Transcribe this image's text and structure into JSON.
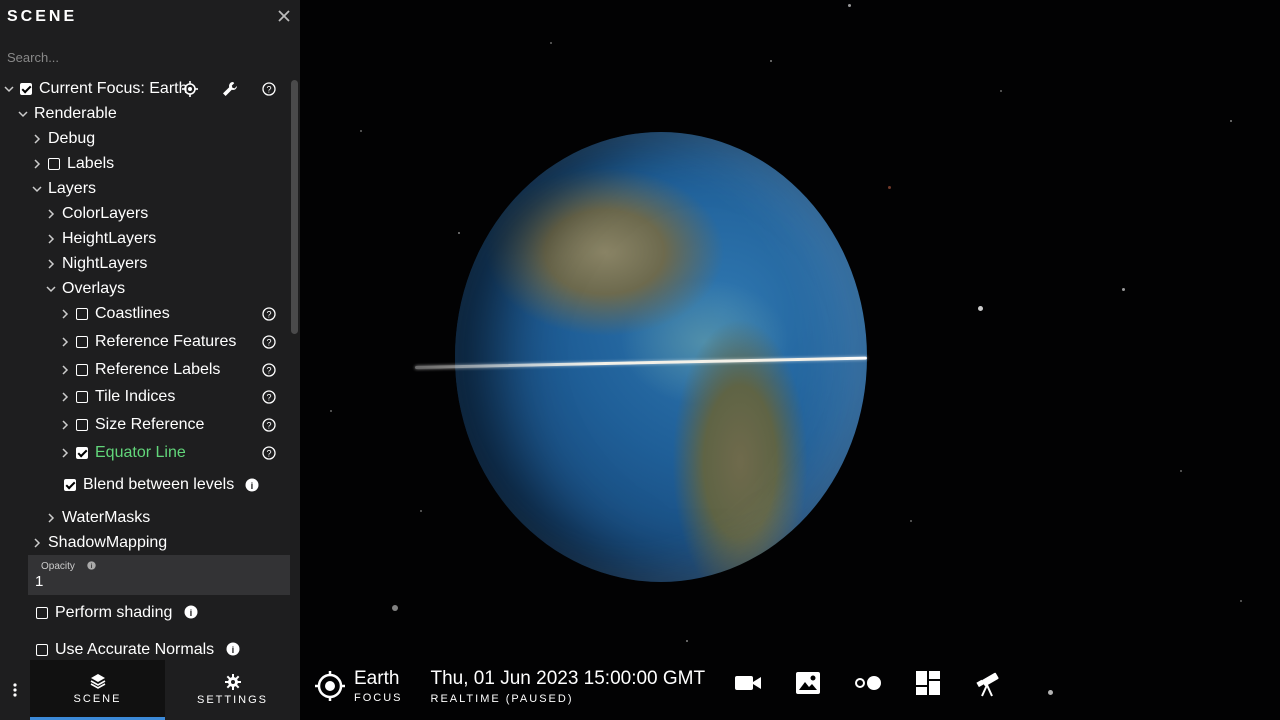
{
  "sidebar": {
    "title": "SCENE",
    "search_placeholder": "Search...",
    "tree": {
      "current_focus": "Current Focus: Earth",
      "renderable": "Renderable",
      "debug": "Debug",
      "labels": "Labels",
      "layers": "Layers",
      "color_layers": "ColorLayers",
      "height_layers": "HeightLayers",
      "night_layers": "NightLayers",
      "overlays": "Overlays",
      "coastlines": "Coastlines",
      "reference_features": "Reference Features",
      "reference_labels": "Reference Labels",
      "tile_indices": "Tile Indices",
      "size_reference": "Size Reference",
      "equator_line": "Equator Line",
      "blend_between_levels": "Blend between levels",
      "water_masks": "WaterMasks",
      "shadow_mapping": "ShadowMapping",
      "perform_shading": "Perform shading",
      "use_accurate_normals": "Use Accurate Normals"
    },
    "opacity": {
      "label": "Opacity",
      "value": "1"
    },
    "tabs": {
      "scene": "SCENE",
      "settings": "SETTINGS"
    }
  },
  "bottom_bar": {
    "focus_name": "Earth",
    "focus_sub": "FOCUS",
    "datetime": "Thu, 01 Jun 2023 15:00:00 GMT",
    "time_status": "REALTIME (PAUSED)"
  },
  "colors": {
    "panel_bg": "#1e1e1f",
    "active_green": "#62d67a",
    "tab_active_underline": "#3c8ad8"
  }
}
